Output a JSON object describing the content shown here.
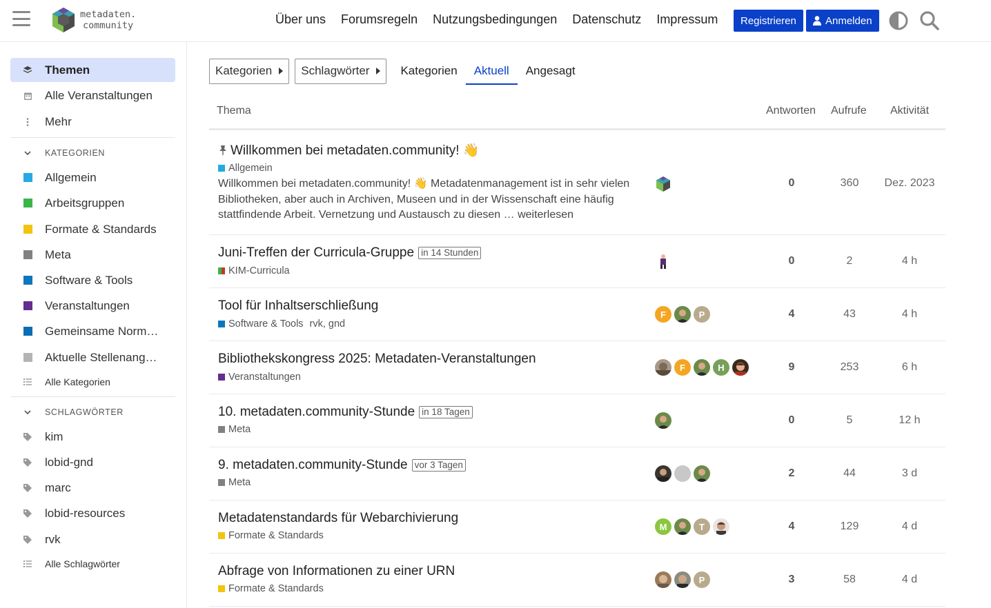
{
  "header": {
    "logo_line1": "metadaten.",
    "logo_line2": "community",
    "nav": [
      "Über uns",
      "Forumsregeln",
      "Nutzungsbedingungen",
      "Datenschutz",
      "Impressum"
    ],
    "register_label": "Registrieren",
    "login_label": "Anmelden"
  },
  "sidebar": {
    "top_items": [
      {
        "label": "Themen",
        "icon": "layers-icon"
      },
      {
        "label": "Alle Veranstaltungen",
        "icon": "calendar-icon"
      },
      {
        "label": "Mehr",
        "icon": "vertical-ellipsis-icon"
      }
    ],
    "categories_heading": "KATEGORIEN",
    "categories": [
      {
        "label": "Allgemein",
        "color": "#25AAE2"
      },
      {
        "label": "Arbeitsgruppen",
        "color": "#3AB54A"
      },
      {
        "label": "Formate & Standards",
        "color": "#F1C40F"
      },
      {
        "label": "Meta",
        "color": "#808281"
      },
      {
        "label": "Software & Tools",
        "color": "#0E76BD"
      },
      {
        "label": "Veranstaltungen",
        "color": "#652D90"
      },
      {
        "label": "Gemeinsame Normdateien",
        "color": "#0C6CB5"
      },
      {
        "label": "Aktuelle Stellenangebote",
        "color": "#B3B5B4"
      }
    ],
    "all_categories": "Alle Kategorien",
    "tags_heading": "SCHLAGWÖRTER",
    "tags": [
      "kim",
      "lobid-gnd",
      "marc",
      "lobid-resources",
      "rvk"
    ],
    "all_tags": "Alle Schlagwörter"
  },
  "filters": {
    "categories_dropdown": "Kategorien",
    "tags_dropdown": "Schlagwörter",
    "tabs": [
      "Kategorien",
      "Aktuell",
      "Angesagt"
    ],
    "active_tab": "Aktuell"
  },
  "table": {
    "headers": {
      "topic": "Thema",
      "replies": "Antworten",
      "views": "Aufrufe",
      "activity": "Aktivität"
    },
    "rows": [
      {
        "title": "Willkommen bei metadaten.community! 👋",
        "pinned": true,
        "category": "Allgemein",
        "category_color": "#25AAE2",
        "excerpt": "Willkommen bei metadaten.community! 👋 Metadatenmanagement ist in sehr vielen Bibliotheken, aber auch in Archiven, Museen und in der Wissenschaft eine häufig stattfindende Arbeit. Vernetzung und Austausch zu diesen …",
        "read_more": "weiterlesen",
        "posters": [
          {
            "type": "logo",
            "color": "#7c5"
          }
        ],
        "replies": "0",
        "views": "360",
        "activity": "Dez. 2023"
      },
      {
        "title": "Juni-Treffen der Curricula-Gruppe",
        "badge": "in 14 Stunden",
        "category": "KIM-Curricula",
        "category_color": "#3AB54A",
        "category_color2": "#c0392b",
        "posters": [
          {
            "type": "figure",
            "color": "#5a2e6e"
          }
        ],
        "replies": "0",
        "views": "2",
        "activity": "4 h"
      },
      {
        "title": "Tool für Inhaltserschließung",
        "category": "Software & Tools",
        "category_color": "#0E76BD",
        "tags_text": "rvk, gnd",
        "posters": [
          {
            "type": "letter",
            "letter": "F",
            "color": "#F4A522"
          },
          {
            "type": "photo",
            "color": "#4a6b3a"
          },
          {
            "type": "letter",
            "letter": "P",
            "color": "#b8ab8d"
          }
        ],
        "replies": "4",
        "views": "43",
        "activity": "4 h"
      },
      {
        "title": "Bibliothekskongress 2025: Metadaten-Veranstaltungen",
        "category": "Veranstaltungen",
        "category_color": "#652D90",
        "posters": [
          {
            "type": "photo",
            "color": "#8a7a6a"
          },
          {
            "type": "letter",
            "letter": "F",
            "color": "#F4A522"
          },
          {
            "type": "photo",
            "color": "#4a6b3a"
          },
          {
            "type": "letter",
            "letter": "H",
            "color": "#78a05a"
          },
          {
            "type": "photo",
            "color": "#7a3a2a"
          }
        ],
        "replies": "9",
        "views": "253",
        "activity": "6 h"
      },
      {
        "title": "10. metadaten.community-Stunde",
        "badge": "in 18 Tagen",
        "category": "Meta",
        "category_color": "#808281",
        "posters": [
          {
            "type": "photo",
            "color": "#4a6b3a"
          }
        ],
        "replies": "0",
        "views": "5",
        "activity": "12 h"
      },
      {
        "title": "9. metadaten.community-Stunde",
        "badge": "vor 3 Tagen",
        "category": "Meta",
        "category_color": "#808281",
        "posters": [
          {
            "type": "photo",
            "color": "#3a3530"
          },
          {
            "type": "letter",
            "letter": "",
            "color": "#c8c8c8"
          },
          {
            "type": "photo",
            "color": "#4a6b3a"
          }
        ],
        "replies": "2",
        "views": "44",
        "activity": "3 d"
      },
      {
        "title": "Metadatenstandards für Webarchivierung",
        "category": "Formate & Standards",
        "category_color": "#F1C40F",
        "posters": [
          {
            "type": "letter",
            "letter": "M",
            "color": "#8cc63f"
          },
          {
            "type": "photo",
            "color": "#4a6b3a"
          },
          {
            "type": "letter",
            "letter": "T",
            "color": "#b8ab8d"
          },
          {
            "type": "photo",
            "color": "#5a4a40"
          }
        ],
        "replies": "4",
        "views": "129",
        "activity": "4 d"
      },
      {
        "title": "Abfrage von Informationen zu einer URN",
        "category": "Formate & Standards",
        "category_color": "#F1C40F",
        "posters": [
          {
            "type": "photo",
            "color": "#9a7a5a"
          },
          {
            "type": "photo",
            "color": "#4a4a4a"
          },
          {
            "type": "letter",
            "letter": "P",
            "color": "#b8ab8d"
          }
        ],
        "replies": "3",
        "views": "58",
        "activity": "4 d"
      }
    ]
  }
}
